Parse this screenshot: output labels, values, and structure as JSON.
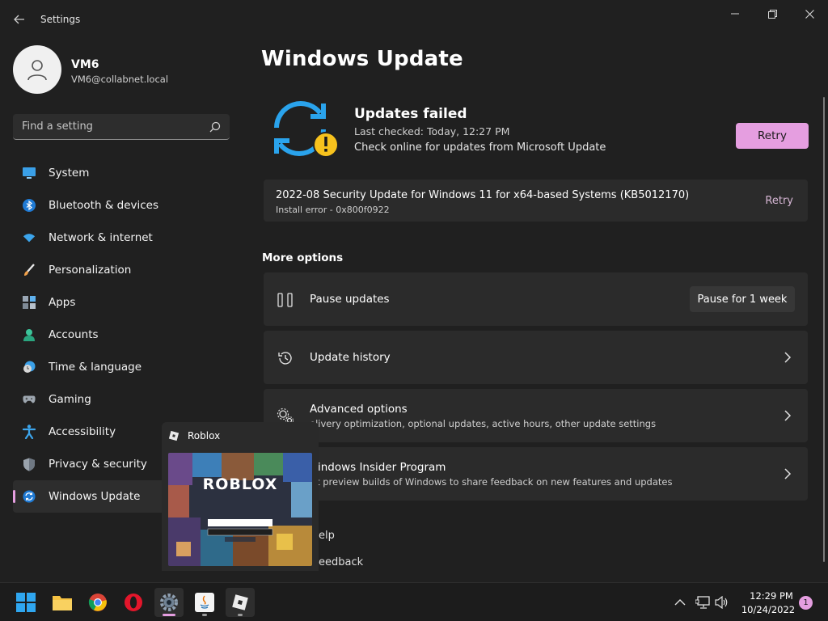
{
  "window": {
    "title": "Settings"
  },
  "user": {
    "name": "VM6",
    "email": "VM6@collabnet.local"
  },
  "search": {
    "placeholder": "Find a setting"
  },
  "sidebar": {
    "items": [
      {
        "label": "System",
        "icon": "monitor-icon"
      },
      {
        "label": "Bluetooth & devices",
        "icon": "bluetooth-icon"
      },
      {
        "label": "Network & internet",
        "icon": "wifi-icon"
      },
      {
        "label": "Personalization",
        "icon": "brush-icon"
      },
      {
        "label": "Apps",
        "icon": "apps-icon"
      },
      {
        "label": "Accounts",
        "icon": "person-icon"
      },
      {
        "label": "Time & language",
        "icon": "clock-globe-icon"
      },
      {
        "label": "Gaming",
        "icon": "gamepad-icon"
      },
      {
        "label": "Accessibility",
        "icon": "accessibility-icon"
      },
      {
        "label": "Privacy & security",
        "icon": "shield-icon"
      },
      {
        "label": "Windows Update",
        "icon": "sync-icon",
        "active": true
      }
    ]
  },
  "main": {
    "title": "Windows Update",
    "status": {
      "title": "Updates failed",
      "last_checked": "Last checked: Today, 12:27 PM",
      "link": "Check online for updates from Microsoft Update",
      "retry_label": "Retry"
    },
    "update": {
      "name": "2022-08 Security Update for Windows 11 for x64-based Systems (KB5012170)",
      "error": "Install error - 0x800f0922",
      "retry_label": "Retry"
    },
    "more_options_heading": "More options",
    "options": {
      "pause": {
        "title": "Pause updates",
        "button": "Pause for 1 week"
      },
      "history": {
        "title": "Update history"
      },
      "advanced": {
        "title": "Advanced options",
        "desc": "elivery optimization, optional updates, active hours, other update settings"
      },
      "insider": {
        "title": "Vindows Insider Program",
        "desc": "et preview builds of Windows to share feedback on new features and updates"
      }
    },
    "help": {
      "get_help": "elp",
      "feedback": "eedback"
    }
  },
  "preview": {
    "title": "Roblox",
    "logo_text": "ROBLOX"
  },
  "taskbar": {
    "time": "12:29 PM",
    "date": "10/24/2022",
    "notification_count": "1"
  },
  "colors": {
    "accent": "#e59ee0",
    "background": "#202020",
    "card": "#2b2b2b"
  }
}
